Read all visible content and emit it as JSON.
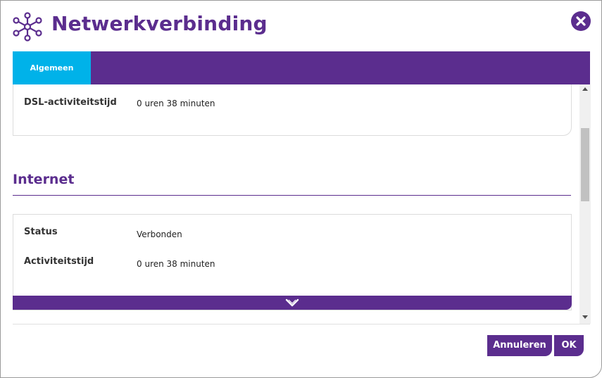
{
  "dialog": {
    "title": "Netwerkverbinding",
    "logo_icon": "network-nodes-icon",
    "close_icon": "close-icon",
    "accent_color": "#5b2d8e",
    "tab_color": "#00b2e9"
  },
  "tabs": [
    {
      "label": "Algemeen",
      "active": true
    }
  ],
  "dsl_section": {
    "rows": [
      {
        "label": "DSL-activiteitstijd",
        "value": "0 uren 38 minuten"
      }
    ]
  },
  "internet_section": {
    "title": "Internet",
    "rows": [
      {
        "label": "Status",
        "value": "Verbonden"
      },
      {
        "label": "Activiteitstijd",
        "value": "0 uren 38 minuten"
      }
    ],
    "expand_icon": "chevron-down-icon"
  },
  "footer": {
    "cancel_label": "Annuleren",
    "ok_label": "OK"
  }
}
